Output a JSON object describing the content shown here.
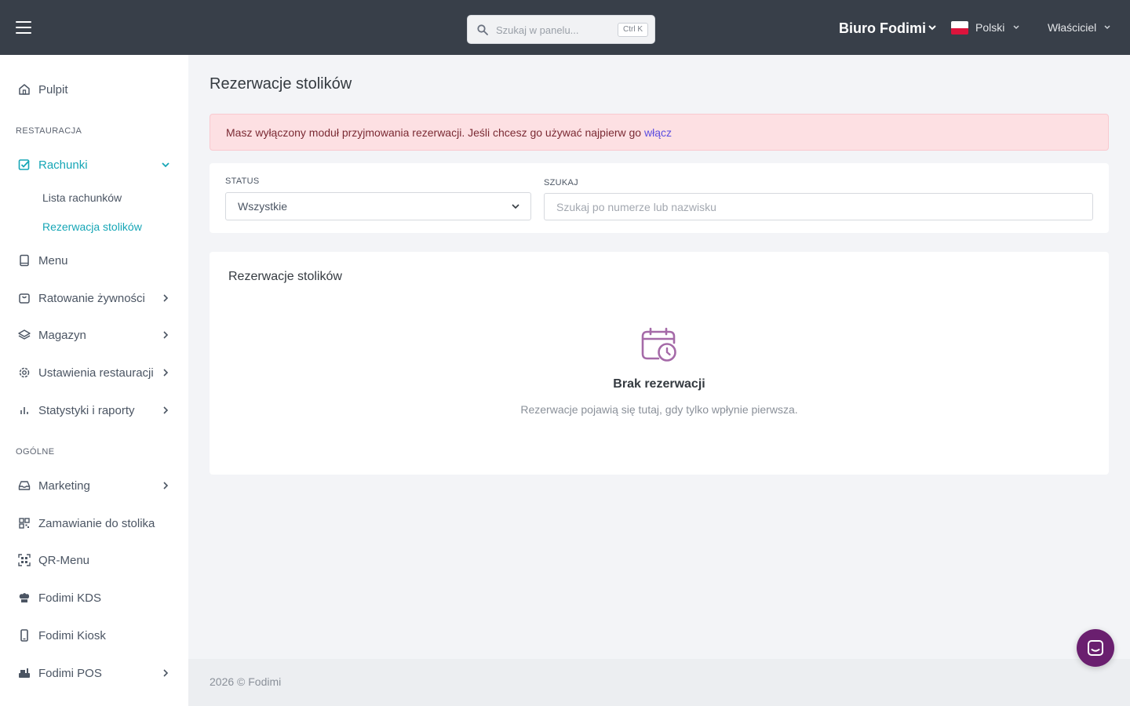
{
  "topbar": {
    "search_placeholder": "Szukaj w panelu...",
    "search_shortcut": "Ctrl K",
    "brand": "Biuro Fodimi",
    "language": "Polski",
    "user_role": "Właściciel"
  },
  "sidebar": {
    "dashboard": "Pulpit",
    "section_restaurant": "RESTAURACJA",
    "bills": "Rachunki",
    "bills_list": "Lista rachunków",
    "table_reservation": "Rezerwacja stolików",
    "menu": "Menu",
    "food_rescue": "Ratowanie żywności",
    "warehouse": "Magazyn",
    "restaurant_settings": "Ustawienia restauracji",
    "stats_reports": "Statystyki i raporty",
    "section_general": "OGÓLNE",
    "marketing": "Marketing",
    "table_ordering": "Zamawianie do stolika",
    "qr_menu": "QR-Menu",
    "kds": "Fodimi KDS",
    "kiosk": "Fodimi Kiosk",
    "pos": "Fodimi POS"
  },
  "main": {
    "title": "Rezerwacje stolików",
    "alert_text": "Masz wyłączony moduł przyjmowania rezerwacji. Jeśli chcesz go używać najpierw go ",
    "alert_link": "włącz",
    "filters": {
      "status_label": "STATUS",
      "status_value": "Wszystkie",
      "search_label": "SZUKAJ",
      "search_placeholder": "Szukaj po numerze lub nazwisku"
    },
    "card": {
      "title": "Rezerwacje stolików",
      "empty_title": "Brak rezerwacji",
      "empty_subtitle": "Rezerwacje pojawią się tutaj, gdy tylko wpłynie pierwsza."
    }
  },
  "footer": {
    "text": "2026 © Fodimi"
  },
  "colors": {
    "accent": "#16a6b6",
    "topbar": "#383f49",
    "chat": "#6a1f6f",
    "empty_icon": "#a56aa8"
  }
}
